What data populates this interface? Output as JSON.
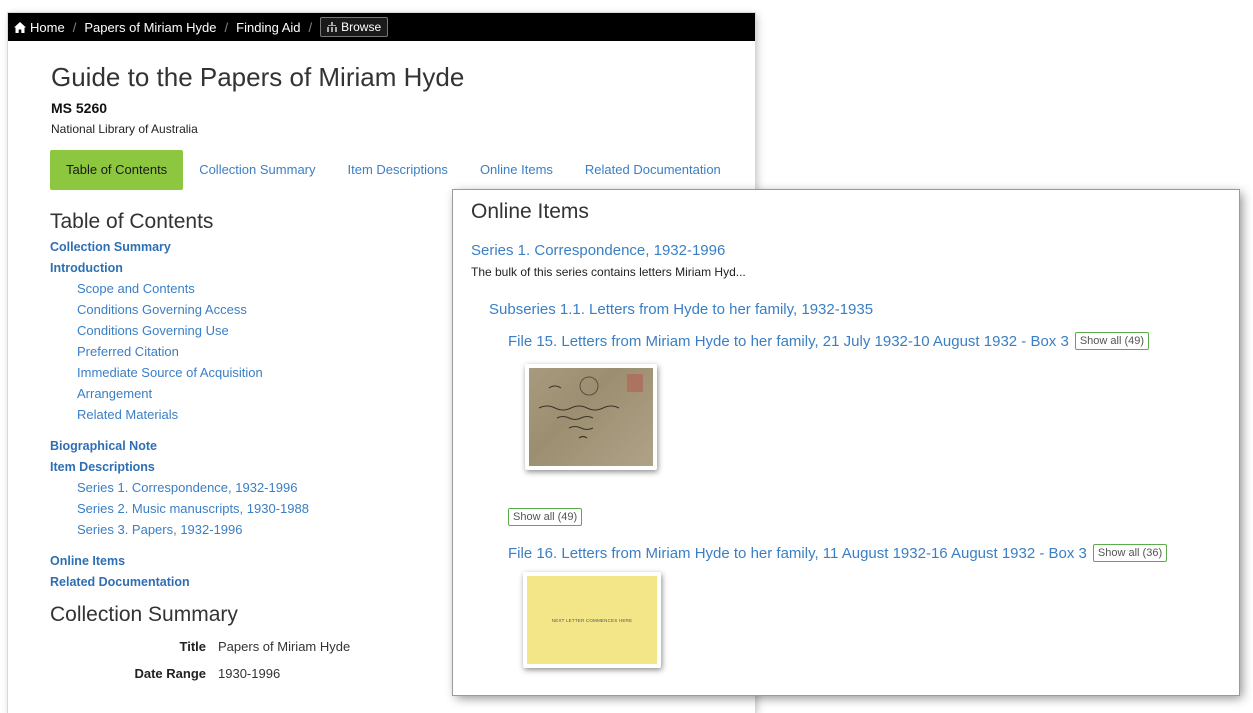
{
  "breadcrumb": {
    "home": "Home",
    "items": [
      "Papers of Miriam Hyde",
      "Finding Aid"
    ],
    "browse": "Browse"
  },
  "header": {
    "title": "Guide to the Papers of Miriam Hyde",
    "ms": "MS 5260",
    "org": "National Library of Australia"
  },
  "tabs": [
    "Table of Contents",
    "Collection Summary",
    "Item Descriptions",
    "Online Items",
    "Related Documentation"
  ],
  "toc": {
    "title": "Table of Contents",
    "collection_summary": "Collection Summary",
    "introduction": "Introduction",
    "intro_items": [
      "Scope and Contents",
      "Conditions Governing Access",
      "Conditions Governing Use",
      "Preferred Citation",
      "Immediate Source of Acquisition",
      "Arrangement",
      "Related Materials"
    ],
    "biographical": "Biographical Note",
    "item_descriptions": "Item Descriptions",
    "series_items": [
      "Series 1. Correspondence, 1932-1996",
      "Series 2. Music manuscripts, 1930-1988",
      "Series 3. Papers, 1932-1996"
    ],
    "online_items": "Online Items",
    "related": "Related Documentation"
  },
  "collection_summary": {
    "title": "Collection Summary",
    "rows": [
      {
        "k": "Title",
        "v": "Papers of Miriam Hyde"
      },
      {
        "k": "Date Range",
        "v": "1930-1996"
      }
    ]
  },
  "online_panel": {
    "title": "Online Items",
    "series": "Series 1. Correspondence, 1932-1996",
    "series_desc": "The bulk of this series contains letters Miriam Hyd...",
    "subseries": "Subseries 1.1. Letters from Hyde to her family, 1932-1935",
    "file1": "File 15. Letters from Miriam Hyde to her family, 21 July 1932-10 August 1932 - Box 3",
    "file1_show": "Show all (49)",
    "show_all": "Show all (49)",
    "file2": "File 16. Letters from Miriam Hyde to her family, 11 August 1932-16 August 1932 - Box 3",
    "file2_show": "Show all (36)",
    "thumb2_text": "NEXT LETTER COMMENCES HERE"
  },
  "colors": {
    "accent_tab": "#8dc63f",
    "link": "#3a7fc4",
    "button_border": "#5cab4c"
  }
}
